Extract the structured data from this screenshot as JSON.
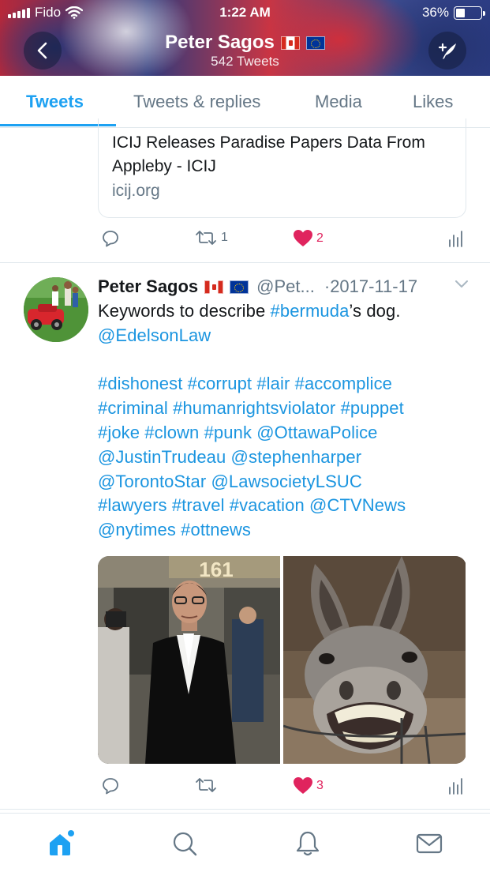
{
  "status_bar": {
    "carrier": "Fido",
    "time": "1:22 AM",
    "battery": "36%",
    "battery_level": 0.36
  },
  "header": {
    "name": "Peter Sagos",
    "tweet_count": "542 Tweets",
    "flags": [
      "canada-flag-icon",
      "eu-flag-icon"
    ],
    "back_icon": "chevron-left-icon",
    "compose_icon": "compose-tweet-icon"
  },
  "tabs": [
    {
      "label": "Tweets",
      "active": true
    },
    {
      "label": "Tweets & replies",
      "active": false
    },
    {
      "label": "Media",
      "active": false
    },
    {
      "label": "Likes",
      "active": false
    }
  ],
  "prev_tweet": {
    "card_title": "ICIJ Releases Paradise Papers Data From Appleby - ICIJ",
    "card_domain": "icij.org",
    "retweets": "1",
    "likes": "2"
  },
  "tweet": {
    "name": "Peter Sagos",
    "handle": "@Pet...",
    "date": "·2017-11-17",
    "body_lines": [
      [
        {
          "t": "Keywords to describe ",
          "link": false
        },
        {
          "t": "#bermuda",
          "link": true
        },
        {
          "t": "’s dog.",
          "link": false
        }
      ],
      [
        {
          "t": "@EdelsonLaw",
          "link": true
        }
      ],
      [],
      [
        {
          "t": "#dishonest #corrupt #lair #accomplice",
          "link": true
        }
      ],
      [
        {
          "t": "#criminal #humanrightsviolator #puppet",
          "link": true
        }
      ],
      [
        {
          "t": "#joke #clown #punk @OttawaPolice",
          "link": true
        }
      ],
      [
        {
          "t": "@JustinTrudeau @stephenharper",
          "link": true
        }
      ],
      [
        {
          "t": "@TorontoStar @LawsocietyLSUC",
          "link": true
        }
      ],
      [
        {
          "t": "#lawyers #travel #vacation @CTVNews",
          "link": true
        }
      ],
      [
        {
          "t": "@nytimes #ottnews",
          "link": true
        }
      ]
    ],
    "media_left_sign": "161",
    "retweets": "",
    "likes": "3"
  },
  "bottom_nav": [
    "home-icon",
    "search-icon",
    "notifications-icon",
    "messages-icon"
  ],
  "colors": {
    "accent": "#1da1f2",
    "link": "#1b95e0",
    "like": "#e0245e",
    "muted": "#657786"
  }
}
